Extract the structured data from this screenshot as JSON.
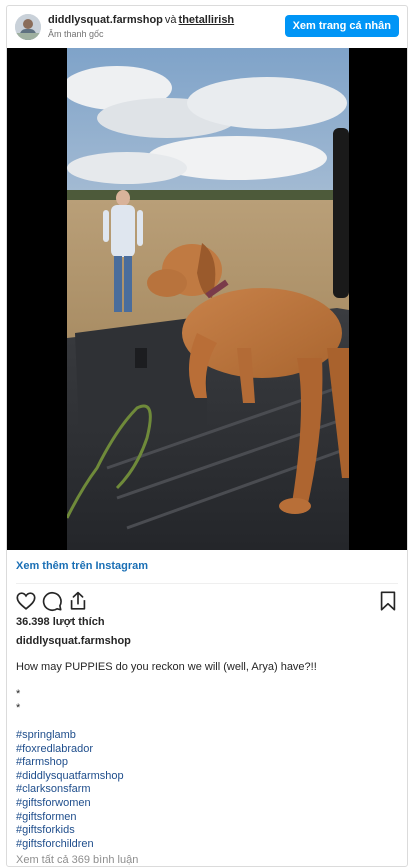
{
  "header": {
    "user1": "diddlysquat.farmshop",
    "connector": "và",
    "user2": "thetallirish",
    "audio": "Âm thanh gốc",
    "profile_button": "Xem trang cá nhân"
  },
  "media": {
    "description_icon": "video-frame"
  },
  "more_link": "Xem thêm trên Instagram",
  "actions": {
    "like_icon": "heart-icon",
    "comment_icon": "comment-icon",
    "share_icon": "share-icon",
    "save_icon": "bookmark-icon"
  },
  "likes": "36.398 lượt thích",
  "owner": "diddlysquat.farmshop",
  "caption": {
    "text": "How may PUPPIES do you reckon we will (well, Arya) have?!!",
    "dot1": "*",
    "dot2": "*",
    "hashtags": [
      "#springlamb",
      "#foxredlabrador",
      "#farmshop",
      "#diddlysquatfarmshop",
      "#clarksonsfarm",
      "#giftsforwomen",
      "#giftsformen",
      "#giftsforkids",
      "#giftsforchildren"
    ]
  },
  "comments_link": "Xem tất cả 369 bình luận",
  "colors": {
    "accent": "#0095f6",
    "link": "#1a6fb5",
    "muted": "#8e8e8e"
  }
}
